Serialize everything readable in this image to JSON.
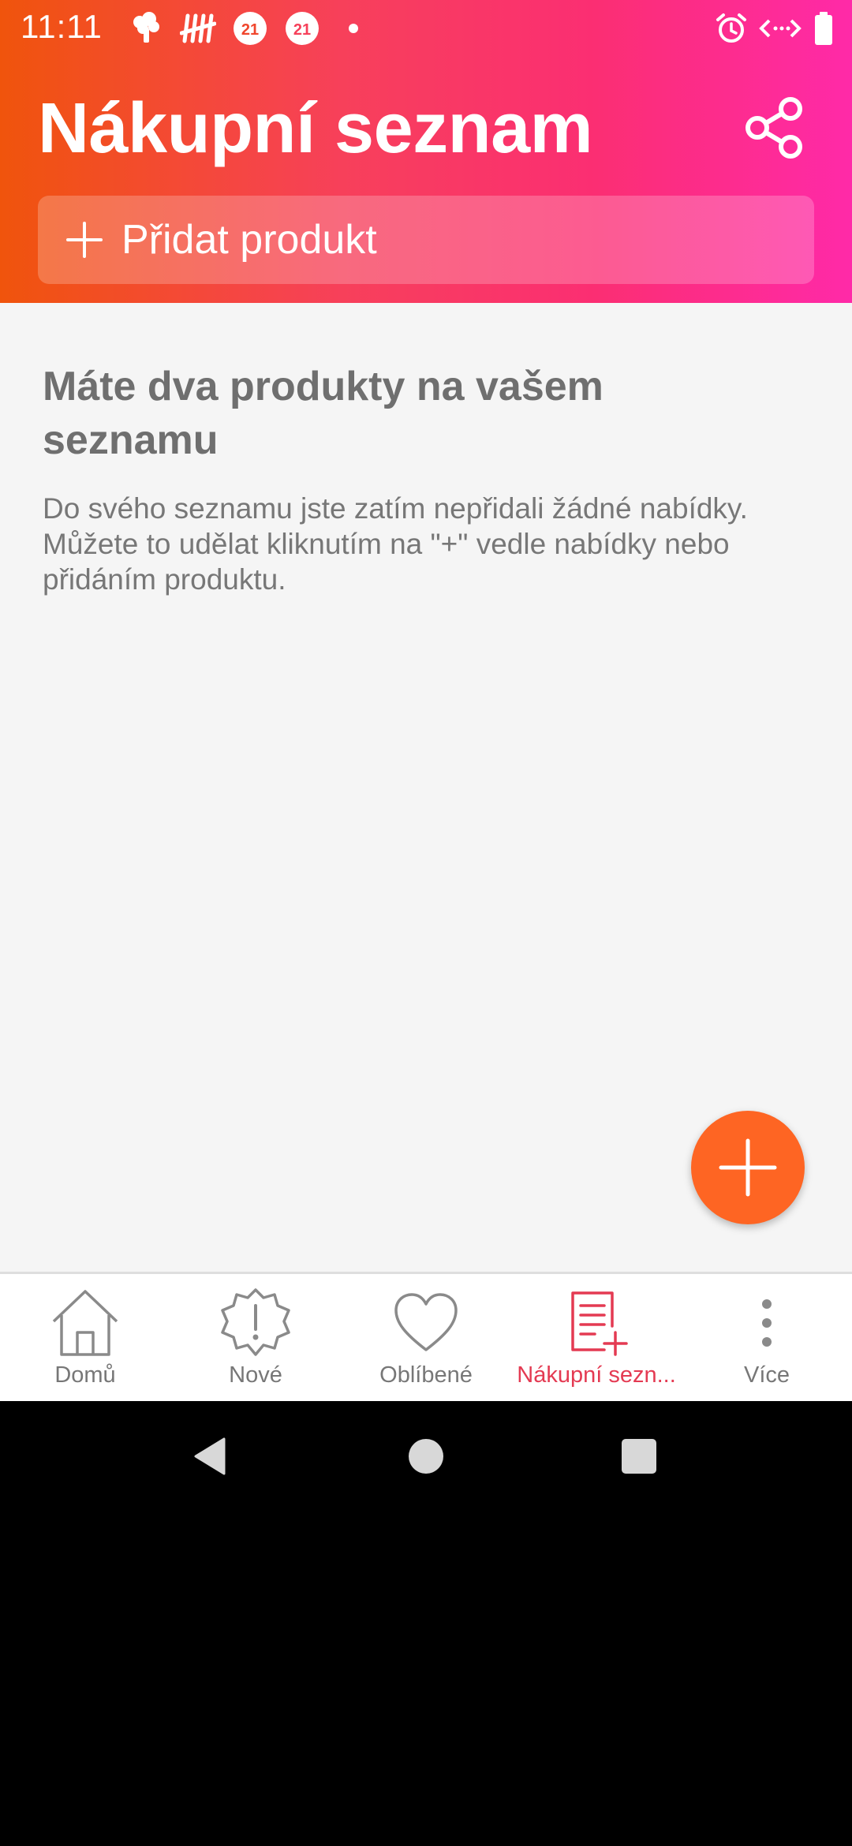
{
  "status_bar": {
    "time": "11:11",
    "badge_1": "21",
    "badge_2": "21"
  },
  "header": {
    "title": "Nákupní seznam",
    "add_product_label": "Přidat produkt"
  },
  "content": {
    "empty_title": "Máte dva produkty na vašem seznamu",
    "empty_description": "Do svého seznamu jste zatím nepřidali žádné nabídky. Můžete to udělat kliknutím na \"+\" vedle nabídky nebo přidáním produktu."
  },
  "bottom_nav": {
    "items": [
      {
        "label": "Domů",
        "icon": "home-icon",
        "active": false
      },
      {
        "label": "Nové",
        "icon": "new-badge-icon",
        "active": false
      },
      {
        "label": "Oblíbené",
        "icon": "heart-icon",
        "active": false
      },
      {
        "label": "Nákupní sezn...",
        "icon": "shopping-list-icon",
        "active": true
      },
      {
        "label": "Více",
        "icon": "more-vertical-icon",
        "active": false
      }
    ]
  },
  "colors": {
    "header_gradient_start": "#f0540c",
    "header_gradient_end": "#ff2aa8",
    "fab": "#fe6523",
    "active_nav": "#e43a52",
    "inactive_nav": "#777777",
    "content_bg": "#f5f5f5"
  }
}
